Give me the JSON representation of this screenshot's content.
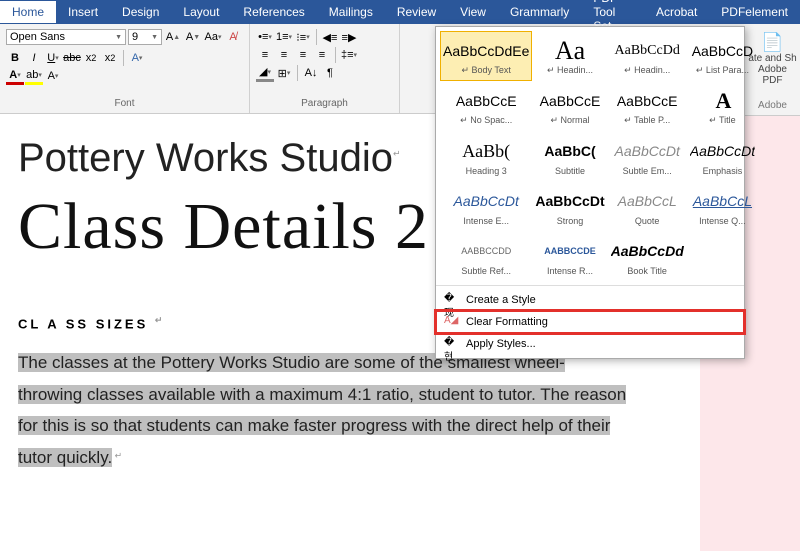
{
  "tabs": [
    "Home",
    "Insert",
    "Design",
    "Layout",
    "References",
    "Mailings",
    "Review",
    "View",
    "Grammarly",
    "PDF Tool Set",
    "Acrobat",
    "PDFelement"
  ],
  "font": {
    "name": "Open Sans",
    "size": "9"
  },
  "groups": {
    "font": "Font",
    "para": "Paragraph"
  },
  "right": {
    "l1": "ate and Sh",
    "l2": "Adobe PDF",
    "l3": "Adobe"
  },
  "styles": [
    {
      "prev": "AaBbCcDdEe",
      "name": "↵ Body Text",
      "cls": ""
    },
    {
      "prev": "Aa",
      "name": "↵ Headin...",
      "cls": "font-family:Georgia;font-size:26px"
    },
    {
      "prev": "AaBbCcDd",
      "name": "↵ Headin...",
      "cls": "font-family:Georgia"
    },
    {
      "prev": "AaBbCcD",
      "name": "↵ List Para...",
      "cls": ""
    },
    {
      "prev": "AaBbCcE",
      "name": "↵ No Spac...",
      "cls": ""
    },
    {
      "prev": "AaBbCcE",
      "name": "↵ Normal",
      "cls": ""
    },
    {
      "prev": "AaBbCcE",
      "name": "↵ Table P...",
      "cls": ""
    },
    {
      "prev": "A",
      "name": "↵ Title",
      "cls": "font-family:Georgia;font-size:22px;font-weight:900;letter-spacing:-2px"
    },
    {
      "prev": "AaBb(",
      "name": "Heading 3",
      "cls": "font-family:Georgia;font-size:18px"
    },
    {
      "prev": "AaBbC(",
      "name": "Subtitle",
      "cls": "font-weight:700"
    },
    {
      "prev": "AaBbCcDt",
      "name": "Subtle Em...",
      "cls": "font-style:italic;color:#888"
    },
    {
      "prev": "AaBbCcDt",
      "name": "Emphasis",
      "cls": "font-style:italic"
    },
    {
      "prev": "AaBbCcDt",
      "name": "Intense E...",
      "cls": "font-style:italic;color:#2b579a"
    },
    {
      "prev": "AaBbCcDt",
      "name": "Strong",
      "cls": "font-weight:700"
    },
    {
      "prev": "AaBbCcL",
      "name": "Quote",
      "cls": "font-style:italic;color:#888"
    },
    {
      "prev": "AaBbCcL",
      "name": "Intense Q...",
      "cls": "font-style:italic;color:#2b579a;text-decoration:underline"
    },
    {
      "prev": "AABBCCDD",
      "name": "Subtle Ref...",
      "cls": "font-size:9px;color:#666"
    },
    {
      "prev": "AABBCCDE",
      "name": "Intense R...",
      "cls": "font-size:9px;color:#2b579a;font-weight:700"
    },
    {
      "prev": "AaBbCcDd",
      "name": "Book Title",
      "cls": "font-style:italic;font-weight:700"
    },
    {
      "prev": "",
      "name": "",
      "cls": ""
    }
  ],
  "menu": {
    "create": "Create a Style",
    "clear": "Clear Formatting",
    "apply": "Apply Styles..."
  },
  "doc": {
    "title1": "Pottery Works Studio",
    "title2": "Class Details 2",
    "h3": "CL A SS SIZES",
    "body": "The classes at the Pottery Works Studio are some of the smallest wheel- throwing classes available with a maximum 4:1 ratio, student to tutor. The reason for this is so that students can make faster progress with the direct help of their tutor quickly."
  }
}
